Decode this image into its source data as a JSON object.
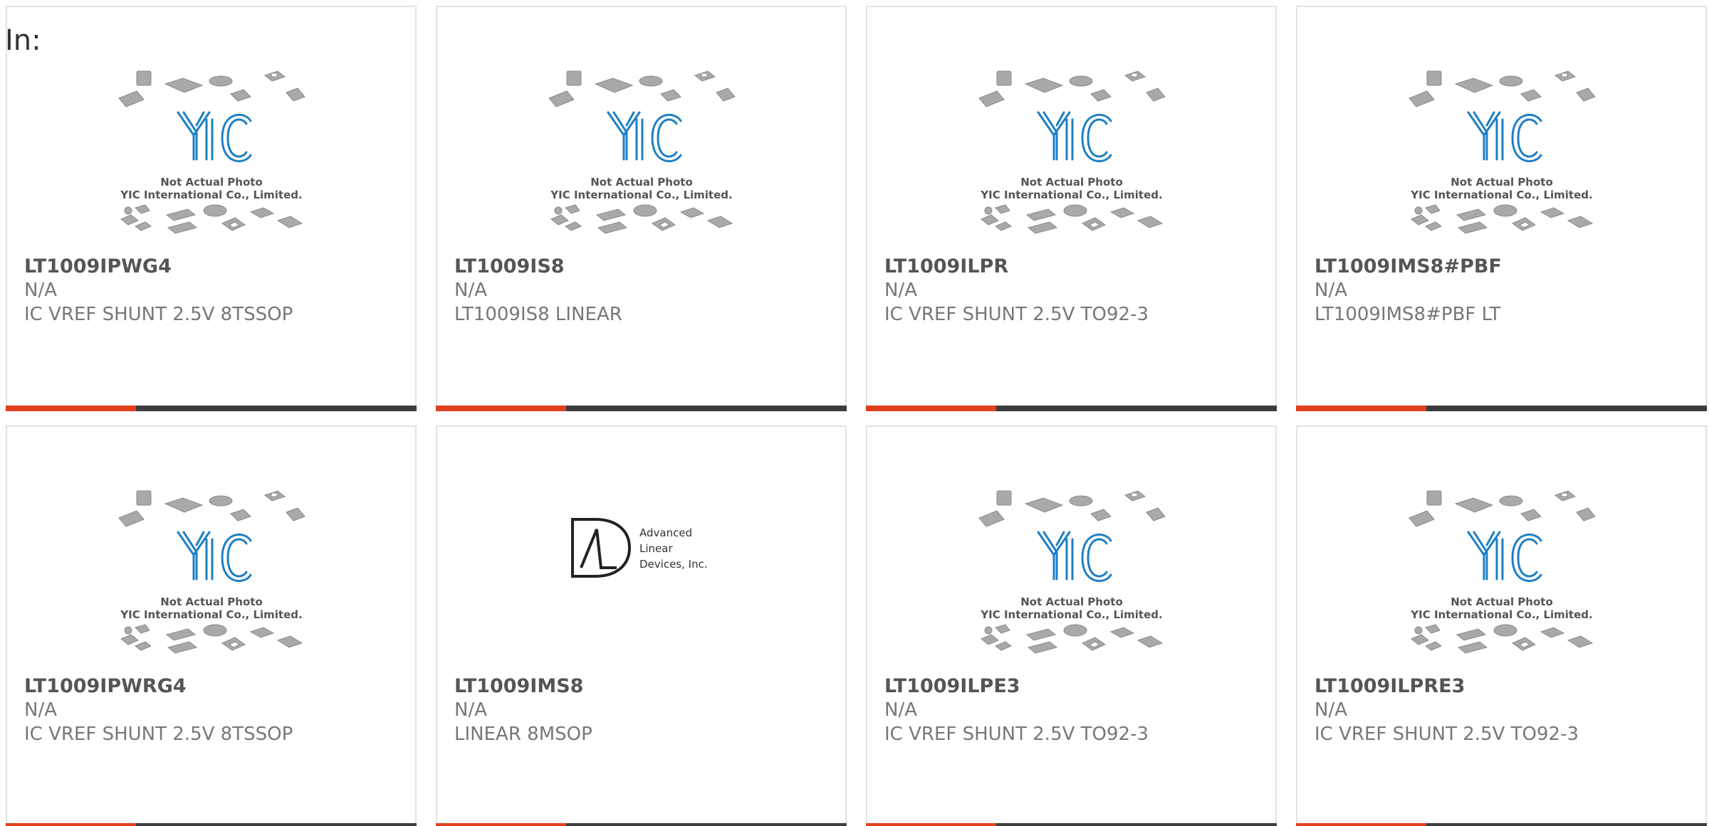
{
  "header": {
    "in_label": "In:"
  },
  "placeholder": {
    "line1": "Not Actual Photo",
    "line2": "YIC International Co., Limited."
  },
  "adi_logo": {
    "line1": "Advanced",
    "line2": "Linear",
    "line3": "Devices, Inc."
  },
  "colors": {
    "accent": "#e2401c",
    "bar": "#3c3c3c",
    "logo_blue": "#1d7fc4",
    "border": "#e3e3e3"
  },
  "products": [
    {
      "part": "LT1009IPWG4",
      "manufacturer": "N/A",
      "description": "IC VREF SHUNT 2.5V 8TSSOP",
      "image": "yic-placeholder"
    },
    {
      "part": "LT1009IS8",
      "manufacturer": "N/A",
      "description": "LT1009IS8 LINEAR",
      "image": "yic-placeholder"
    },
    {
      "part": "LT1009ILPR",
      "manufacturer": "N/A",
      "description": "IC VREF SHUNT 2.5V TO92-3",
      "image": "yic-placeholder"
    },
    {
      "part": "LT1009IMS8#PBF",
      "manufacturer": "N/A",
      "description": "LT1009IMS8#PBF LT",
      "image": "yic-placeholder"
    },
    {
      "part": "LT1009IPWRG4",
      "manufacturer": "N/A",
      "description": "IC VREF SHUNT 2.5V 8TSSOP",
      "image": "yic-placeholder"
    },
    {
      "part": "LT1009IMS8",
      "manufacturer": "N/A",
      "description": "LINEAR 8MSOP",
      "image": "adi-logo"
    },
    {
      "part": "LT1009ILPE3",
      "manufacturer": "N/A",
      "description": "IC VREF SHUNT 2.5V TO92-3",
      "image": "yic-placeholder"
    },
    {
      "part": "LT1009ILPRE3",
      "manufacturer": "N/A",
      "description": "IC VREF SHUNT 2.5V TO92-3",
      "image": "yic-placeholder"
    }
  ]
}
